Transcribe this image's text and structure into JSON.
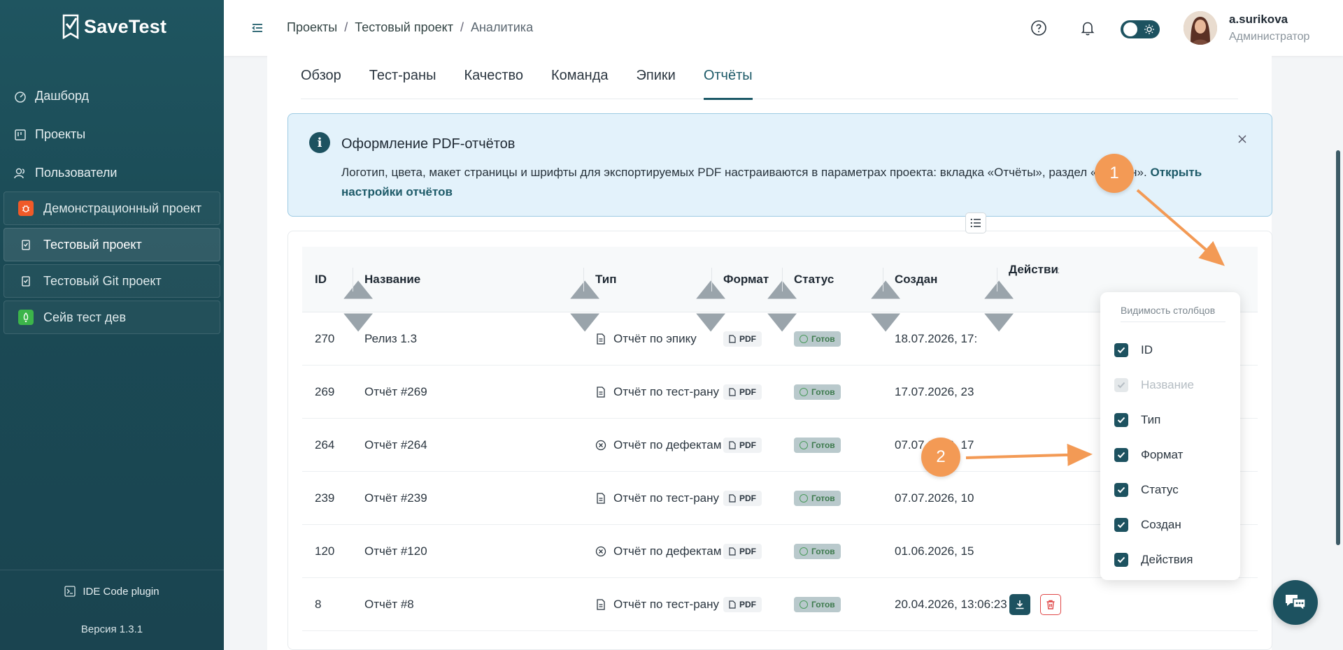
{
  "app": {
    "name": "SaveTest"
  },
  "sidebar": {
    "nav": [
      {
        "label": "Дашборд",
        "icon": "dashboard-icon"
      },
      {
        "label": "Проекты",
        "icon": "projects-icon"
      },
      {
        "label": "Пользователи",
        "icon": "users-icon"
      }
    ],
    "projects": [
      {
        "label": "Демонстрационный проект",
        "color": "#f05a28",
        "active": false
      },
      {
        "label": "Тестовый проект",
        "color": "#1d5260",
        "active": true
      },
      {
        "label": "Тестовый Git проект",
        "color": "#1d5260",
        "active": false
      },
      {
        "label": "Сейв тест дев",
        "color": "#3cb54a",
        "active": false
      }
    ],
    "ide_label": "IDE Code plugin",
    "version": "Версия 1.3.1"
  },
  "topbar": {
    "breadcrumb": [
      "Проекты",
      "Тестовый проект",
      "Аналитика"
    ],
    "user_name": "a.surikova",
    "user_role": "Администратор"
  },
  "tabs": [
    "Обзор",
    "Тест-раны",
    "Качество",
    "Команда",
    "Эпики",
    "Отчёты"
  ],
  "active_tab": "Отчёты",
  "info": {
    "title": "Оформление PDF-отчётов",
    "text": "Логотип, цвета, макет страницы и шрифты для экспортируемых PDF настраиваются в параметрах проекта: вкладка «Отчёты», раздел «Дизайн».",
    "link": "Открыть настройки отчётов"
  },
  "table": {
    "columns": [
      "ID",
      "Название",
      "Тип",
      "Формат",
      "Статус",
      "Создан",
      "Действия"
    ],
    "rows": [
      {
        "id": "270",
        "name": "Релиз 1.3",
        "type": "Отчёт по эпику",
        "type_icon": "doc",
        "format": "PDF",
        "status": "Готов",
        "created": "18.07.2026, 17:"
      },
      {
        "id": "269",
        "name": "Отчёт #269",
        "type": "Отчёт по тест-рану",
        "type_icon": "doc",
        "format": "PDF",
        "status": "Готов",
        "created": "17.07.2026, 23"
      },
      {
        "id": "264",
        "name": "Отчёт #264",
        "type": "Отчёт по дефектам",
        "type_icon": "bug",
        "format": "PDF",
        "status": "Готов",
        "created": "07.07.2026, 17"
      },
      {
        "id": "239",
        "name": "Отчёт #239",
        "type": "Отчёт по тест-рану",
        "type_icon": "doc",
        "format": "PDF",
        "status": "Готов",
        "created": "07.07.2026, 10"
      },
      {
        "id": "120",
        "name": "Отчёт #120",
        "type": "Отчёт по дефектам",
        "type_icon": "bug",
        "format": "PDF",
        "status": "Готов",
        "created": "01.06.2026, 15"
      },
      {
        "id": "8",
        "name": "Отчёт #8",
        "type": "Отчёт по тест-рану",
        "type_icon": "doc",
        "format": "PDF",
        "status": "Готов",
        "created": "20.04.2026, 13:06:23"
      }
    ]
  },
  "column_menu": {
    "title": "Видимость столбцов",
    "items": [
      {
        "label": "ID",
        "checked": true,
        "disabled": false
      },
      {
        "label": "Название",
        "checked": true,
        "disabled": true
      },
      {
        "label": "Тип",
        "checked": true,
        "disabled": false
      },
      {
        "label": "Формат",
        "checked": true,
        "disabled": false
      },
      {
        "label": "Статус",
        "checked": true,
        "disabled": false
      },
      {
        "label": "Создан",
        "checked": true,
        "disabled": false
      },
      {
        "label": "Действия",
        "checked": true,
        "disabled": false
      }
    ]
  },
  "annotations": [
    "1",
    "2"
  ],
  "colors": {
    "primary": "#1d5260",
    "accent": "#f39a55",
    "danger": "#e04848"
  }
}
